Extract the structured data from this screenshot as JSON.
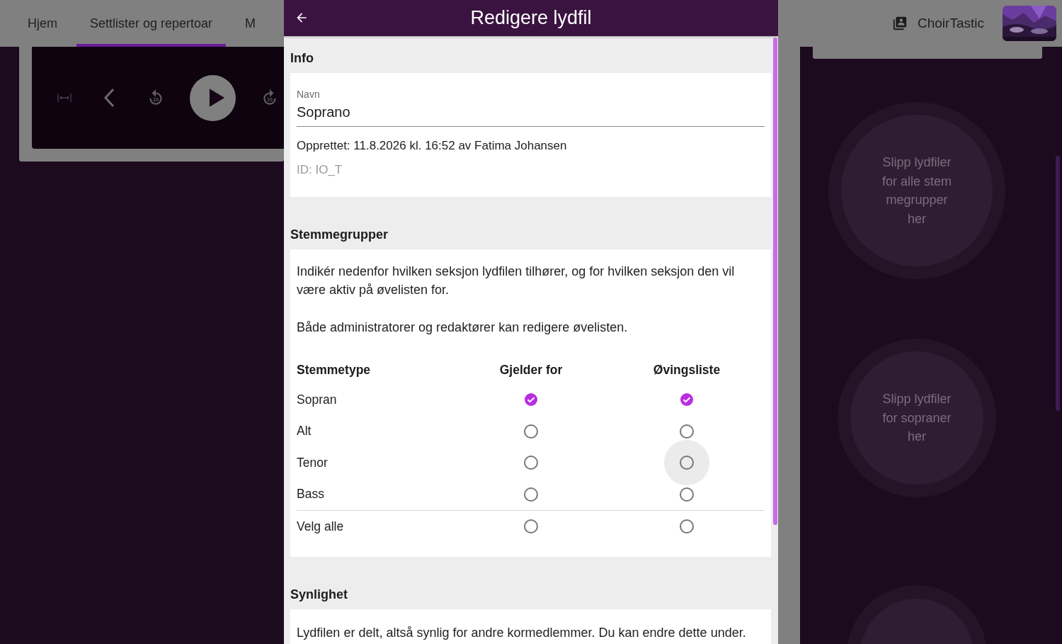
{
  "top_bar": {
    "tabs": [
      {
        "label": "Hjem",
        "selected": false
      },
      {
        "label": "Settlister og repertoar",
        "selected": true
      },
      {
        "label": "M",
        "selected": false
      }
    ],
    "choir_name": "ChoirTastic"
  },
  "player": {
    "skip_back_label": "10",
    "skip_forward_label": "10"
  },
  "drop_zones": [
    {
      "text": "Slipp lydfiler\nfor alle stem\nmegrupper\nher"
    },
    {
      "text": "Slipp lydfiler\nfor sopraner\nher"
    }
  ],
  "dialog": {
    "title": "Redigere lydfil",
    "info": {
      "heading": "Info",
      "field_label": "Navn",
      "field_value": "Soprano",
      "created": "Opprettet: 11.8.2026 kl. 16:52 av Fatima Johansen",
      "id": "ID: IO_T"
    },
    "voice_groups": {
      "heading": "Stemmegrupper",
      "paragraphs": [
        "Indikér nedenfor hvilken seksjon lydfilen tilhører, og for hvilken seksjon den vil være aktiv på øvelisten for.",
        "Både administratorer og redaktører kan redigere øvelisten."
      ],
      "columns": [
        "Stemmetype",
        "Gjelder for",
        "Øvingsliste"
      ],
      "rows": [
        {
          "name": "Sopran",
          "applies": {
            "checked": true,
            "hovered": false
          },
          "practice": {
            "checked": true,
            "hovered": false
          }
        },
        {
          "name": "Alt",
          "applies": {
            "checked": false,
            "hovered": false
          },
          "practice": {
            "checked": false,
            "hovered": false
          }
        },
        {
          "name": "Tenor",
          "applies": {
            "checked": false,
            "hovered": false
          },
          "practice": {
            "checked": false,
            "hovered": true
          }
        },
        {
          "name": "Bass",
          "applies": {
            "checked": false,
            "hovered": false
          },
          "practice": {
            "checked": false,
            "hovered": false
          }
        }
      ],
      "select_all": {
        "name": "Velg alle",
        "applies": {
          "checked": false,
          "hovered": false
        },
        "practice": {
          "checked": false,
          "hovered": false
        }
      }
    },
    "visibility": {
      "heading": "Synlighet",
      "text": "Lydfilen er delt, altså synlig for andre kormedlemmer. Du kan endre dette under."
    }
  }
}
